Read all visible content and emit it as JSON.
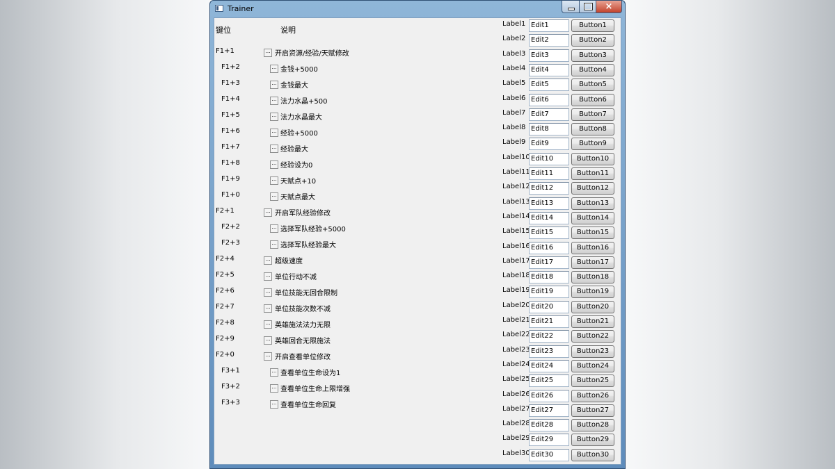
{
  "window": {
    "title": "Trainer",
    "icon": "app-window-icon"
  },
  "header": {
    "key_col": "键位",
    "desc_col": "说明"
  },
  "hotkeys": [
    {
      "key": "F1+1",
      "desc": "开启资源/经验/天赋修改",
      "indent": false
    },
    {
      "key": "F1+2",
      "desc": "金钱+5000",
      "indent": true
    },
    {
      "key": "F1+3",
      "desc": "金钱最大",
      "indent": true
    },
    {
      "key": "F1+4",
      "desc": "法力水晶+500",
      "indent": true
    },
    {
      "key": "F1+5",
      "desc": "法力水晶最大",
      "indent": true
    },
    {
      "key": "F1+6",
      "desc": "经验+5000",
      "indent": true
    },
    {
      "key": "F1+7",
      "desc": "经验最大",
      "indent": true
    },
    {
      "key": "F1+8",
      "desc": "经验设为0",
      "indent": true
    },
    {
      "key": "F1+9",
      "desc": "天赋点+10",
      "indent": true
    },
    {
      "key": "F1+0",
      "desc": "天赋点最大",
      "indent": true
    },
    {
      "key": "F2+1",
      "desc": "开启军队经验修改",
      "indent": false
    },
    {
      "key": "F2+2",
      "desc": "选择军队经验+5000",
      "indent": true
    },
    {
      "key": "F2+3",
      "desc": "选择军队经验最大",
      "indent": true
    },
    {
      "key": "F2+4",
      "desc": "超级速度",
      "indent": false
    },
    {
      "key": "F2+5",
      "desc": "单位行动不减",
      "indent": false
    },
    {
      "key": "F2+6",
      "desc": "单位技能无回合限制",
      "indent": false
    },
    {
      "key": "F2+7",
      "desc": "单位技能次数不减",
      "indent": false
    },
    {
      "key": "F2+8",
      "desc": "英雄施法法力无限",
      "indent": false
    },
    {
      "key": "F2+9",
      "desc": "英雄回合无限施法",
      "indent": false
    },
    {
      "key": "F2+0",
      "desc": "开启查看单位修改",
      "indent": false
    },
    {
      "key": "F3+1",
      "desc": "查看单位生命设为1",
      "indent": true
    },
    {
      "key": "F3+2",
      "desc": "查看单位生命上限增强",
      "indent": true
    },
    {
      "key": "F3+3",
      "desc": "查看单位生命回复",
      "indent": true
    }
  ],
  "checkbox_glyph": "...",
  "controls": [
    {
      "label": "Label1",
      "edit": "Edit1",
      "button": "Button1"
    },
    {
      "label": "Label2",
      "edit": "Edit2",
      "button": "Button2"
    },
    {
      "label": "Label3",
      "edit": "Edit3",
      "button": "Button3"
    },
    {
      "label": "Label4",
      "edit": "Edit4",
      "button": "Button4"
    },
    {
      "label": "Label5",
      "edit": "Edit5",
      "button": "Button5"
    },
    {
      "label": "Label6",
      "edit": "Edit6",
      "button": "Button6"
    },
    {
      "label": "Label7",
      "edit": "Edit7",
      "button": "Button7"
    },
    {
      "label": "Label8",
      "edit": "Edit8",
      "button": "Button8"
    },
    {
      "label": "Label9",
      "edit": "Edit9",
      "button": "Button9"
    },
    {
      "label": "Label10",
      "edit": "Edit10",
      "button": "Button10"
    },
    {
      "label": "Label11",
      "edit": "Edit11",
      "button": "Button11"
    },
    {
      "label": "Label12",
      "edit": "Edit12",
      "button": "Button12"
    },
    {
      "label": "Label13",
      "edit": "Edit13",
      "button": "Button13"
    },
    {
      "label": "Label14",
      "edit": "Edit14",
      "button": "Button14"
    },
    {
      "label": "Label15",
      "edit": "Edit15",
      "button": "Button15"
    },
    {
      "label": "Label16",
      "edit": "Edit16",
      "button": "Button16"
    },
    {
      "label": "Label17",
      "edit": "Edit17",
      "button": "Button17"
    },
    {
      "label": "Label18",
      "edit": "Edit18",
      "button": "Button18"
    },
    {
      "label": "Label19",
      "edit": "Edit19",
      "button": "Button19"
    },
    {
      "label": "Label20",
      "edit": "Edit20",
      "button": "Button20"
    },
    {
      "label": "Label21",
      "edit": "Edit21",
      "button": "Button21"
    },
    {
      "label": "Label22",
      "edit": "Edit22",
      "button": "Button22"
    },
    {
      "label": "Label23",
      "edit": "Edit23",
      "button": "Button23"
    },
    {
      "label": "Label24",
      "edit": "Edit24",
      "button": "Button24"
    },
    {
      "label": "Label25",
      "edit": "Edit25",
      "button": "Button25"
    },
    {
      "label": "Label26",
      "edit": "Edit26",
      "button": "Button26"
    },
    {
      "label": "Label27",
      "edit": "Edit27",
      "button": "Button27"
    },
    {
      "label": "Label28",
      "edit": "Edit28",
      "button": "Button28"
    },
    {
      "label": "Label29",
      "edit": "Edit29",
      "button": "Button29"
    },
    {
      "label": "Label30",
      "edit": "Edit30",
      "button": "Button30"
    }
  ]
}
